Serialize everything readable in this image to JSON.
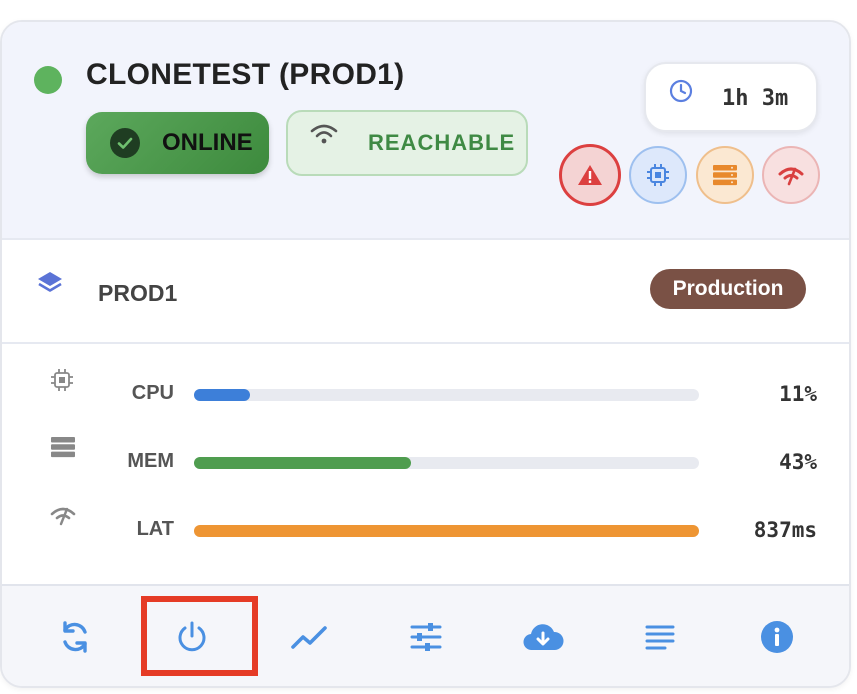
{
  "server": {
    "title": "CLONETEST (PROD1)",
    "status_color": "#5eb35e",
    "online_label": "ONLINE",
    "reachable_label": "REACHABLE",
    "uptime": "1h 3m"
  },
  "alerts": [
    {
      "name": "warning-icon",
      "color": "#dc4040"
    },
    {
      "name": "cpu-icon",
      "color": "#4a86e0"
    },
    {
      "name": "memory-icon",
      "color": "#e8892d"
    },
    {
      "name": "latency-icon",
      "color": "#d94040"
    }
  ],
  "environment": {
    "name": "PROD1",
    "badge": "Production",
    "badge_color": "#7a5145"
  },
  "metrics": [
    {
      "label": "CPU",
      "value": "11%",
      "fraction": 0.11,
      "color": "#3d7fd9",
      "icon": "cpu-icon"
    },
    {
      "label": "MEM",
      "value": "43%",
      "fraction": 0.43,
      "color": "#4f9d4f",
      "icon": "memory-icon"
    },
    {
      "label": "LAT",
      "value": "837ms",
      "fraction": 1.0,
      "color": "#ee9533",
      "icon": "latency-icon"
    }
  ],
  "toolbar": [
    {
      "name": "refresh-button",
      "icon": "refresh-icon"
    },
    {
      "name": "power-button",
      "icon": "power-icon"
    },
    {
      "name": "metrics-chart-button",
      "icon": "chart-line-icon"
    },
    {
      "name": "settings-button",
      "icon": "sliders-icon"
    },
    {
      "name": "download-button",
      "icon": "cloud-download-icon"
    },
    {
      "name": "logs-button",
      "icon": "list-icon"
    },
    {
      "name": "info-button",
      "icon": "info-icon"
    }
  ],
  "accent_color": "#4a90e2",
  "highlight_color": "#e53b26"
}
